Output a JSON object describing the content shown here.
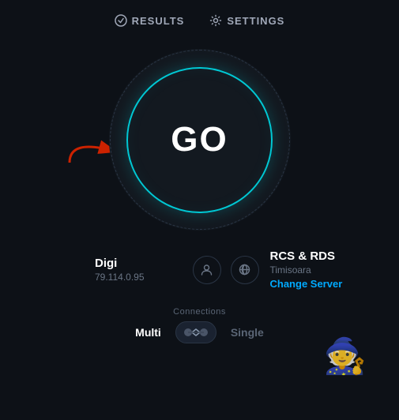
{
  "nav": {
    "results_label": "RESULTS",
    "settings_label": "SETTINGS"
  },
  "gauge": {
    "go_label": "GO"
  },
  "isp": {
    "name": "Digi",
    "ip": "79.114.0.95"
  },
  "server": {
    "name": "RCS & RDS",
    "location": "Timisoara",
    "change_label": "Change Server"
  },
  "connections": {
    "label": "Connections",
    "multi": "Multi",
    "single": "Single"
  },
  "icons": {
    "results_icon": "✓",
    "settings_icon": "⚙",
    "user_icon": "👤",
    "globe_icon": "🌐",
    "arrows_icon": "⇄"
  },
  "colors": {
    "accent_cyan": "#00c8d4",
    "accent_blue": "#00aaff",
    "bg_dark": "#0d1117"
  }
}
